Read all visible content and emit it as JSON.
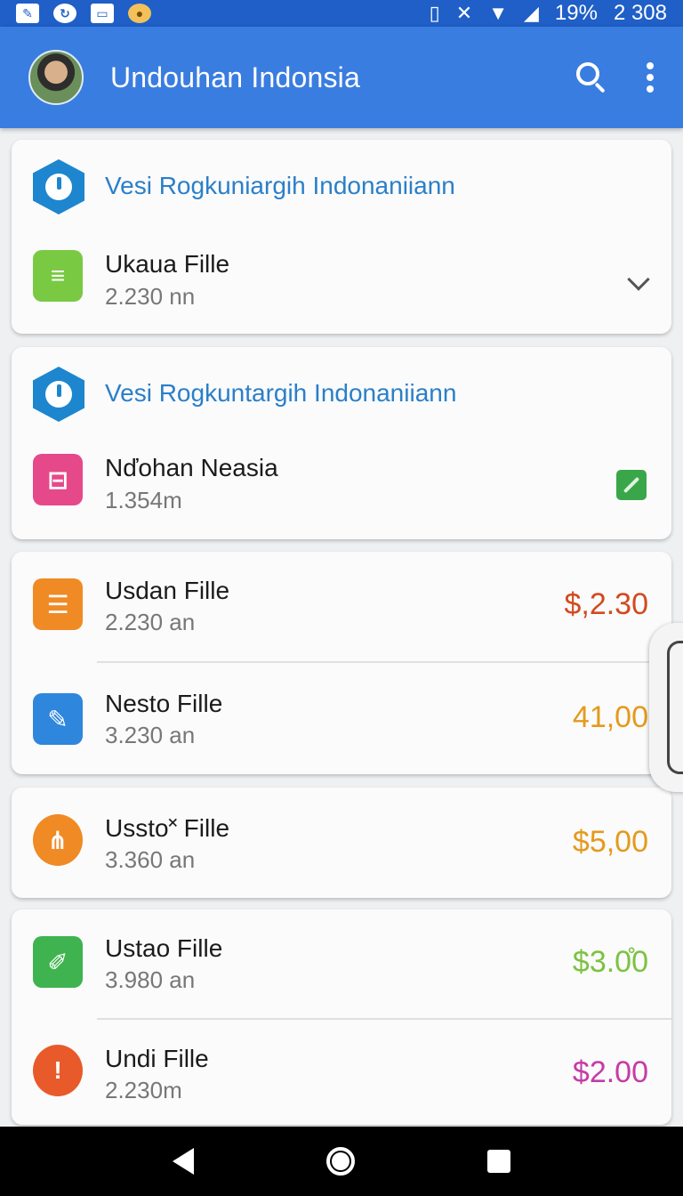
{
  "status_bar": {
    "battery": "19%",
    "time": "2 308",
    "left_icons": [
      "edit-icon",
      "sync-icon",
      "keyboard-icon",
      "coin-icon"
    ],
    "right_icons": [
      "vibrate-icon",
      "mute-icon",
      "wifi-icon",
      "signal-icon"
    ]
  },
  "app_bar": {
    "title": "Undouhan Indonsia",
    "actions": [
      "search-icon",
      "more-vert-icon"
    ],
    "color": "#3a7de0"
  },
  "groups": [
    {
      "header": "Vesi Rogkuniargih Indonaniiann",
      "header_icon": "hexagon-app-icon",
      "items": [
        {
          "name": "Ukaua Fille",
          "size": "2.230 nn",
          "icon": "document-icon",
          "icon_color": "#7ac943",
          "trailing": "chevron-down-icon"
        }
      ]
    },
    {
      "header": "Vesi Rogkuntargih Indonaniiann",
      "header_icon": "hexagon-app-icon",
      "items": [
        {
          "name": "Nďohan Neasia",
          "size": "1.354m",
          "icon": "sheet-icon",
          "icon_color": "#e6498a",
          "trailing": "check-badge-icon"
        }
      ]
    },
    {
      "items": [
        {
          "name": "Usdan Fille",
          "size": "2.230 an",
          "icon": "list-doc-icon",
          "icon_color": "#f08a24",
          "amount": "$,2.30",
          "amount_color": "#d24a1f"
        },
        {
          "name": "Nesto Fille",
          "size": "3.230 an",
          "icon": "pen-icon",
          "icon_color": "#2f86dd",
          "amount": "41,00",
          "amount_color": "#e49a1c"
        }
      ]
    },
    {
      "items": [
        {
          "name": "Ussto˟ Fille",
          "size": "3.360 an",
          "icon": "branch-icon",
          "icon_color": "#f08a24",
          "amount": "$5,00",
          "amount_color": "#e49a1c"
        }
      ]
    },
    {
      "items": [
        {
          "name": "Ustao Fille",
          "size": "3.980 an",
          "icon": "edit-pencil-icon",
          "icon_color": "#3fb34f",
          "amount": "$3.0̊0",
          "amount_color": "#7cc242"
        },
        {
          "name": "Undi Fille",
          "size": "2.230m",
          "icon": "alert-icon",
          "icon_color": "#e85a2a",
          "amount": "$2.00",
          "amount_color": "#c53ba6"
        }
      ]
    }
  ],
  "nav_bar": [
    "back-icon",
    "home-icon",
    "recents-icon"
  ]
}
